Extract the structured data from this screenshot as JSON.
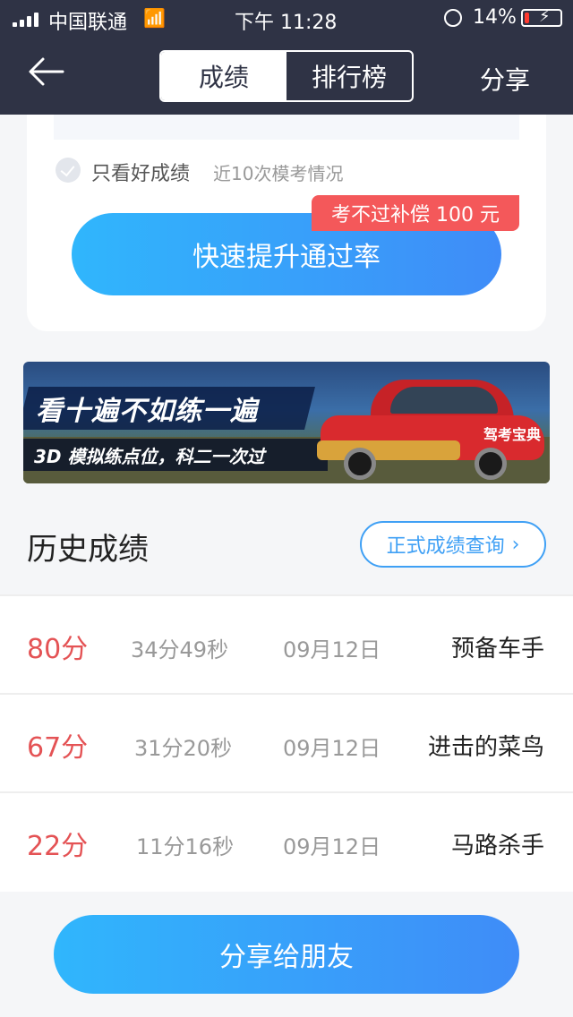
{
  "status_bar": {
    "carrier": "中国联通",
    "time": "下午 11:28",
    "battery_pct": "14%",
    "battery_level": 0.14
  },
  "header": {
    "back_icon": "arrow-left-icon",
    "tabs": [
      {
        "label": "成绩",
        "active": true
      },
      {
        "label": "排行榜",
        "active": false
      }
    ],
    "share_label": "分享"
  },
  "card": {
    "filter_label": "只看好成绩",
    "recent_label": "近10次模考情况",
    "boost_button": "快速提升通过率",
    "compensation_badge": "考不过补偿 100 元"
  },
  "banner": {
    "headline": "看十遍不如练一遍",
    "subline": "3D 模拟练点位，科二一次过",
    "car_label": "驾考宝典"
  },
  "history": {
    "title": "历史成绩",
    "query_button": "正式成绩查询",
    "rows": [
      {
        "score": "80分",
        "duration": "34分49秒",
        "date": "09月12日",
        "rank": "预备车手"
      },
      {
        "score": "67分",
        "duration": "31分20秒",
        "date": "09月12日",
        "rank": "进击的菜鸟"
      },
      {
        "score": "22分",
        "duration": "11分16秒",
        "date": "09月12日",
        "rank": "马路杀手"
      }
    ]
  },
  "footer": {
    "share_button": "分享给朋友"
  },
  "colors": {
    "header_bg": "#2f3345",
    "accent_blue": "#3f8cf8",
    "score_red": "#e45355",
    "badge_red": "#f4585a"
  }
}
